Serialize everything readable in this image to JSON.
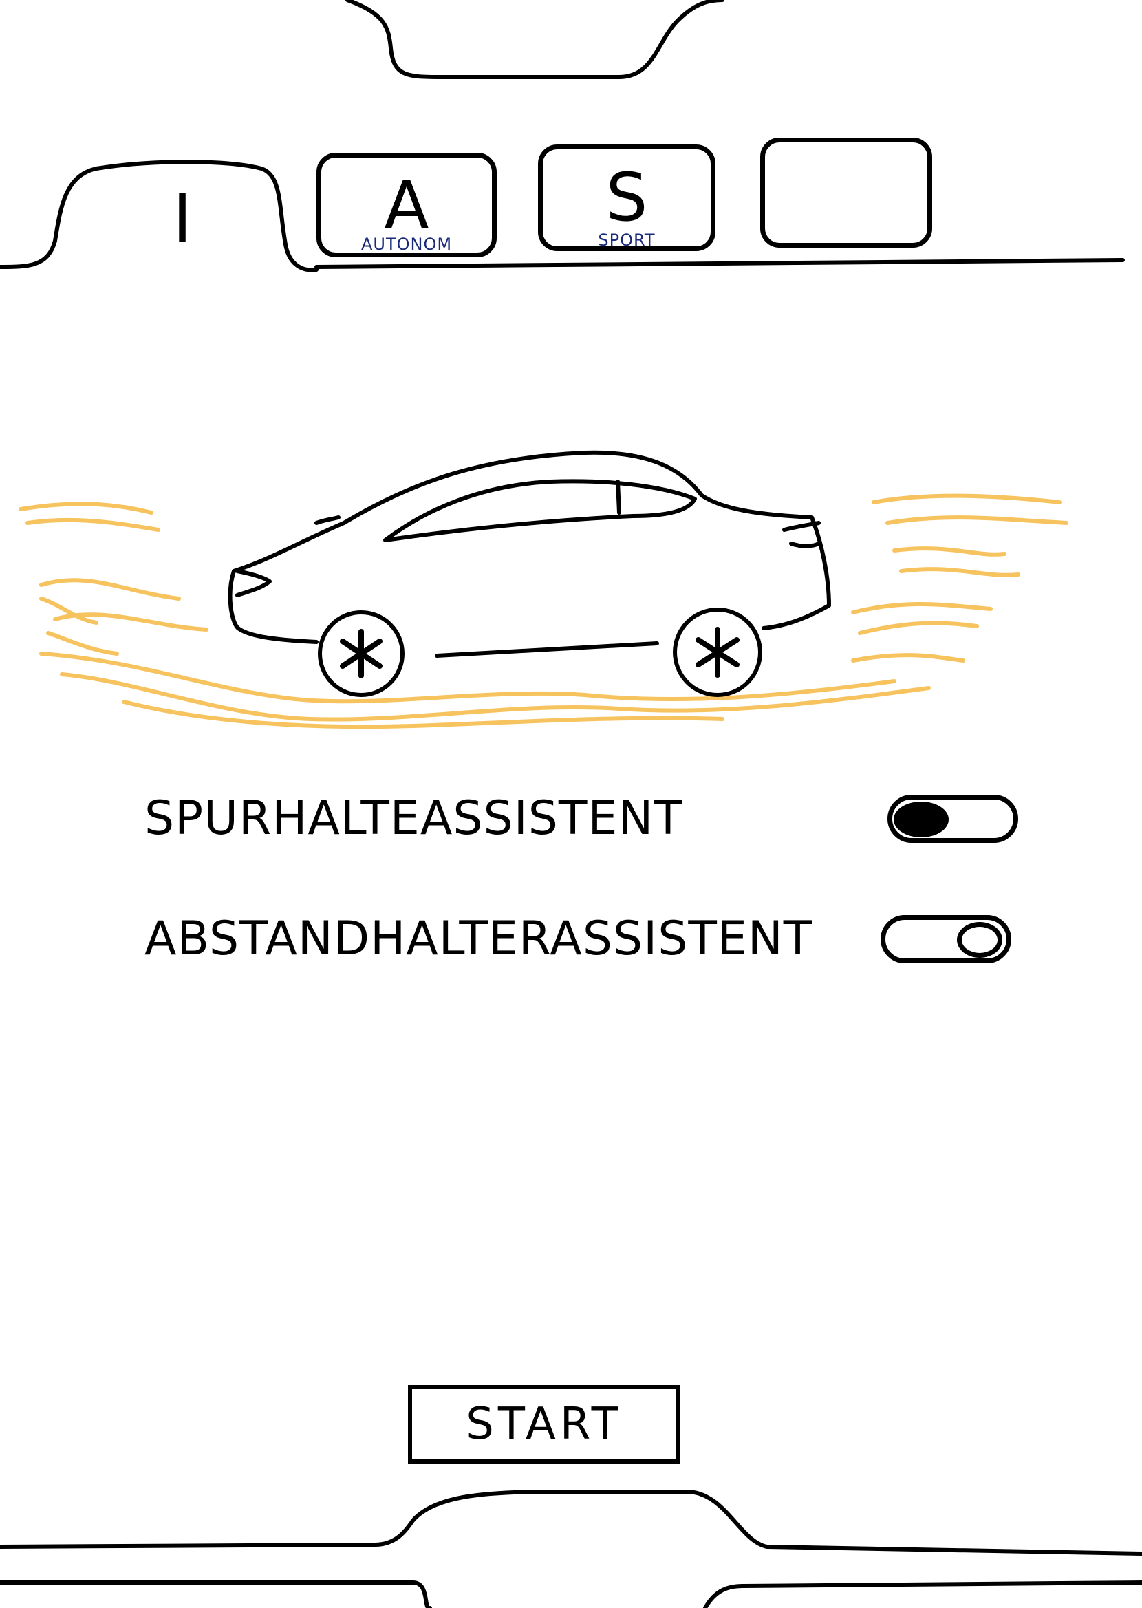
{
  "tabs": [
    {
      "label": "I",
      "sublabel": "",
      "active": true
    },
    {
      "label": "A",
      "sublabel": "AUTONOM",
      "active": false
    },
    {
      "label": "S",
      "sublabel": "SPORT",
      "active": false
    },
    {
      "label": "",
      "sublabel": "",
      "active": false
    }
  ],
  "hero": {
    "icon": "car-icon",
    "highlight_color": "#f5b942"
  },
  "settings": [
    {
      "label": "SPURHALTEASSISTENT",
      "enabled": true
    },
    {
      "label": "ABSTANDHALTERASSISTENT",
      "enabled": false
    }
  ],
  "start_label": "START"
}
